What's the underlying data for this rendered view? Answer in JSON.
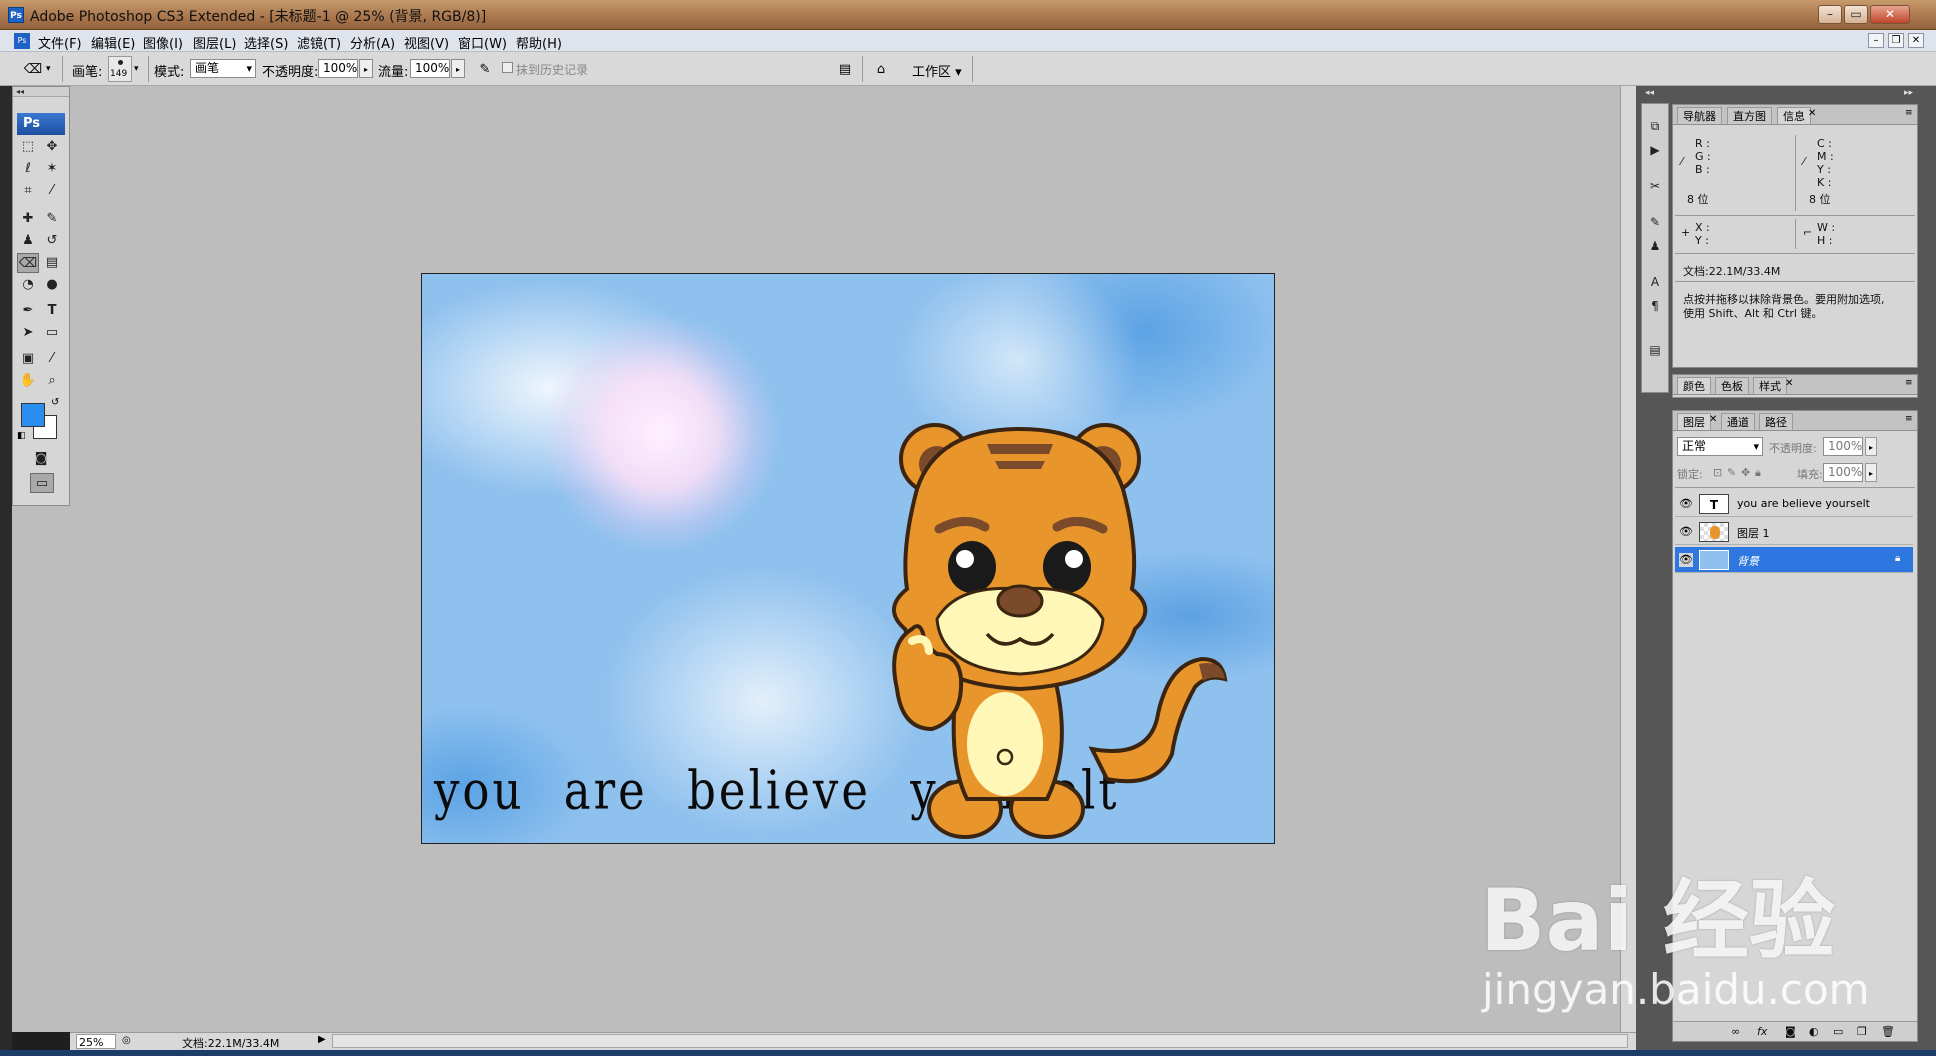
{
  "titlebar": {
    "app_icon": "Ps",
    "title": "Adobe Photoshop CS3 Extended - [未标题-1 @ 25% (背景, RGB/8)]",
    "min": "–",
    "max": "▭",
    "close": "✕"
  },
  "menubar": {
    "items": [
      "文件(F)",
      "编辑(E)",
      "图像(I)",
      "图层(L)",
      "选择(S)",
      "滤镜(T)",
      "分析(A)",
      "视图(V)",
      "窗口(W)",
      "帮助(H)"
    ]
  },
  "options": {
    "brush_label": "画笔:",
    "brush_size": "149",
    "mode_label": "模式:",
    "mode_value": "画笔",
    "opacity_label": "不透明度:",
    "opacity_value": "100%",
    "flow_label": "流量:",
    "flow_value": "100%",
    "erase_history_label": "抹到历史记录",
    "workspace_label": "工作区 ▾"
  },
  "toolbox": {
    "logo": "Ps"
  },
  "canvas": {
    "text": "you are believe yourselt"
  },
  "statusbar": {
    "zoom": "25%",
    "doc": "文档:22.1M/33.4M"
  },
  "info_panel": {
    "tabs": [
      "导航器",
      "直方图",
      "信息"
    ],
    "r": "R :",
    "g": "G :",
    "b": "B :",
    "bits_left": "8 位",
    "c": "C :",
    "m": "M :",
    "y": "Y :",
    "k": "K :",
    "bits_right": "8 位",
    "x": "X :",
    "y2": "Y :",
    "w": "W :",
    "h": "H :",
    "doc": "文档:22.1M/33.4M",
    "hint_line1": "点按并拖移以抹除背景色。要用附加选项,",
    "hint_line2": "使用 Shift、Alt 和 Ctrl 键。"
  },
  "color_panel": {
    "tabs": [
      "颜色",
      "色板",
      "样式"
    ]
  },
  "layers_panel": {
    "tabs": [
      "图层",
      "通道",
      "路径"
    ],
    "blend_mode": "正常",
    "opacity_label": "不透明度:",
    "opacity_value": "100%",
    "lock_label": "锁定:",
    "fill_label": "填充:",
    "fill_value": "100%",
    "layers": [
      {
        "name": "you are believe yourselt",
        "thumb": "T"
      },
      {
        "name": "图层 1",
        "thumb": ""
      },
      {
        "name": "背景",
        "thumb": ""
      }
    ]
  },
  "watermark": {
    "main": "Bai 经验",
    "sub": "jingyan.baidu.com"
  },
  "colors": {
    "foreground": "#2a8ef0",
    "background": "#ffffff",
    "selected_layer": "#2f77e0"
  }
}
